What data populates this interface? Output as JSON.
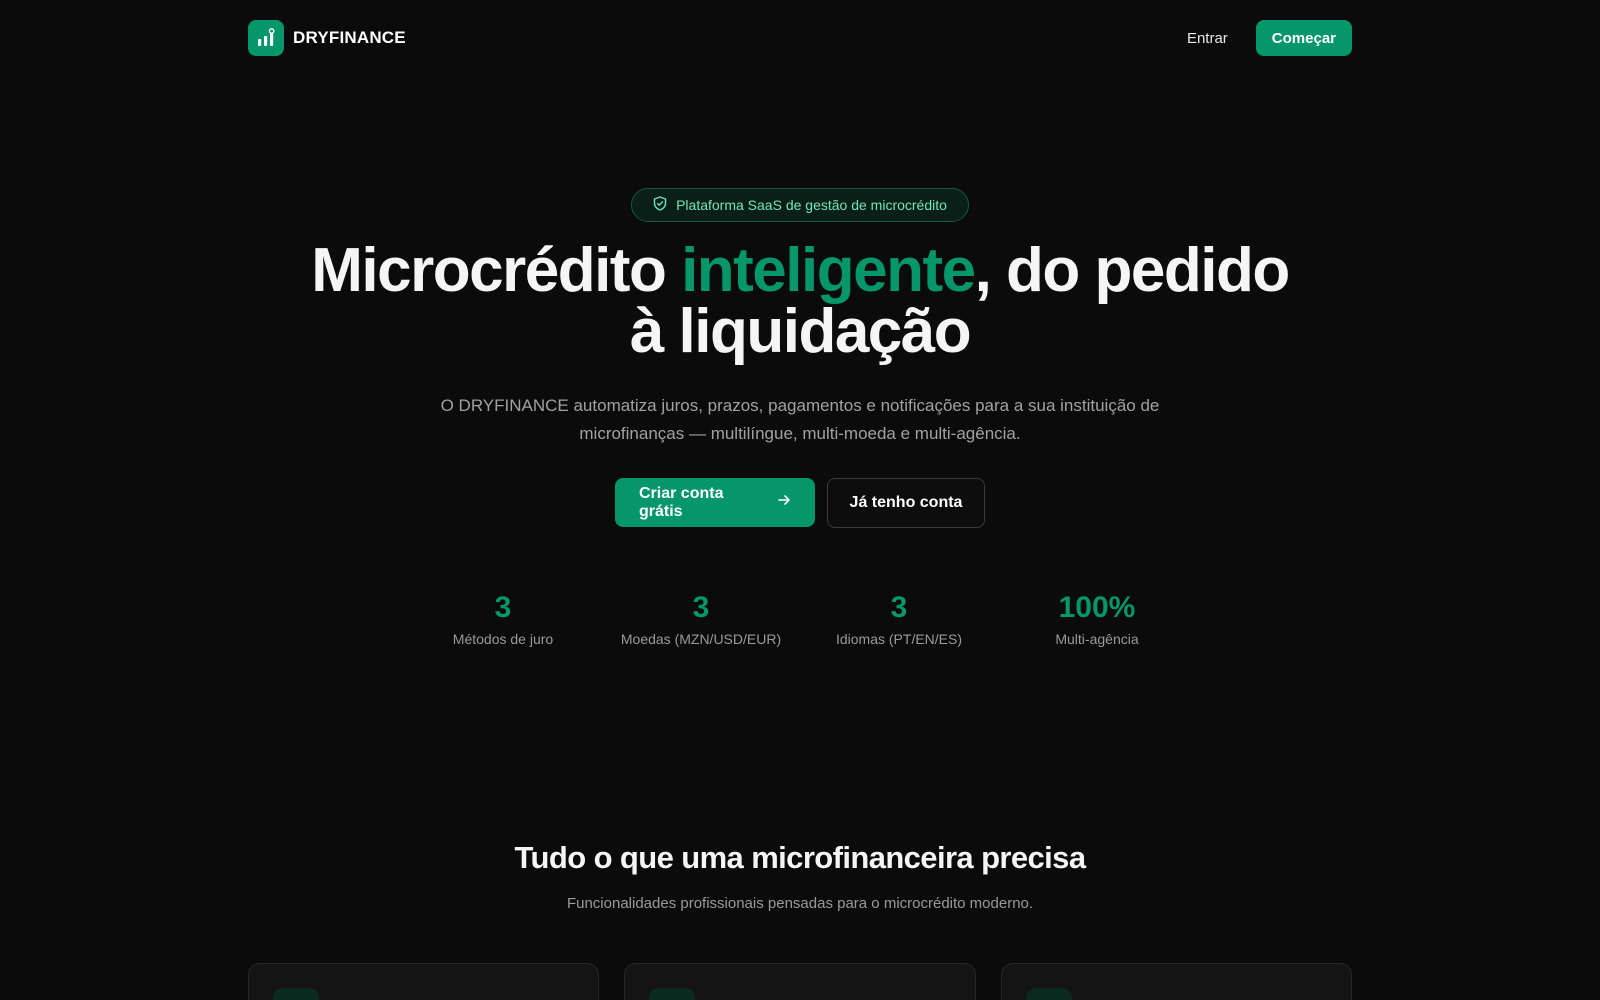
{
  "nav": {
    "brand": "DRYFINANCE",
    "login_label": "Entrar",
    "start_label": "Começar"
  },
  "hero": {
    "badge": "Plataforma SaaS de gestão de microcrédito",
    "title_part1": "Microcrédito ",
    "title_accent": "inteligente",
    "title_part2": ", do pedido à liquidação",
    "subtitle": "O DRYFINANCE automatiza juros, prazos, pagamentos e notificações para a sua instituição de microfinanças — multilíngue, multi-moeda e multi-agência.",
    "cta_primary": "Criar conta grátis",
    "cta_secondary": "Já tenho conta"
  },
  "stats": [
    {
      "value": "3",
      "label": "Métodos de juro"
    },
    {
      "value": "3",
      "label": "Moedas (MZN/USD/EUR)"
    },
    {
      "value": "3",
      "label": "Idiomas (PT/EN/ES)"
    },
    {
      "value": "100%",
      "label": "Multi-agência"
    }
  ],
  "features": {
    "title": "Tudo o que uma microfinanceira precisa",
    "subtitle": "Funcionalidades profissionais pensadas para o microcrédito moderno."
  },
  "colors": {
    "accent": "#059669",
    "background": "#0b0b0b"
  },
  "icons": {
    "logo": "bar-chart-icon",
    "badge": "shield-check-icon",
    "cta": "arrow-right-icon"
  }
}
